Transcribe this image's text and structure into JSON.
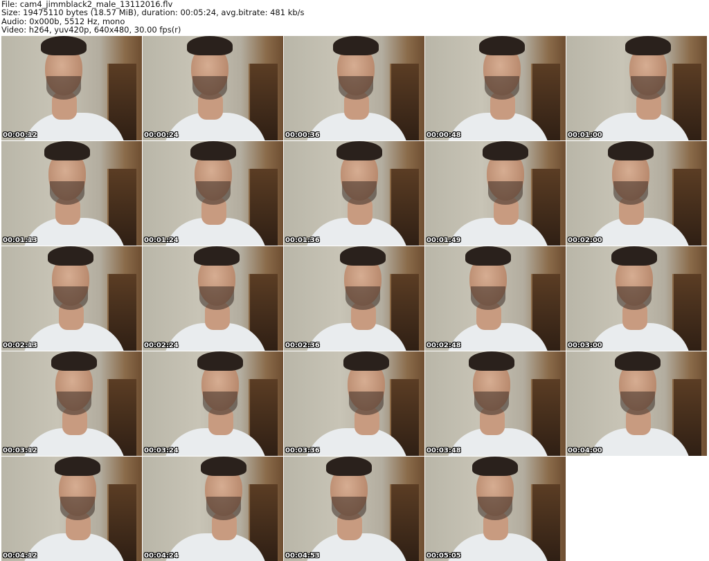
{
  "header": {
    "file": "File: cam4_jimmblack2_male_13112016.flv",
    "size": "Size: 19475110 bytes (18.57 MiB), duration: 00:05:24, avg.bitrate: 481 kb/s",
    "audio": "Audio: 0x000b, 5512 Hz, mono",
    "video": "Video: h264, yuv420p, 640x480, 30.00 fps(r)"
  },
  "thumbnails": [
    {
      "time": "00:00:12"
    },
    {
      "time": "00:00:24"
    },
    {
      "time": "00:00:36"
    },
    {
      "time": "00:00:48"
    },
    {
      "time": "00:01:00"
    },
    {
      "time": "00:01:13"
    },
    {
      "time": "00:01:24"
    },
    {
      "time": "00:01:36"
    },
    {
      "time": "00:01:49"
    },
    {
      "time": "00:02:00"
    },
    {
      "time": "00:02:13"
    },
    {
      "time": "00:02:24"
    },
    {
      "time": "00:02:36"
    },
    {
      "time": "00:02:48"
    },
    {
      "time": "00:03:00"
    },
    {
      "time": "00:03:12"
    },
    {
      "time": "00:03:24"
    },
    {
      "time": "00:03:36"
    },
    {
      "time": "00:03:48"
    },
    {
      "time": "00:04:00"
    },
    {
      "time": "00:04:12"
    },
    {
      "time": "00:04:24"
    },
    {
      "time": "00:04:53"
    },
    {
      "time": "00:05:05"
    }
  ]
}
